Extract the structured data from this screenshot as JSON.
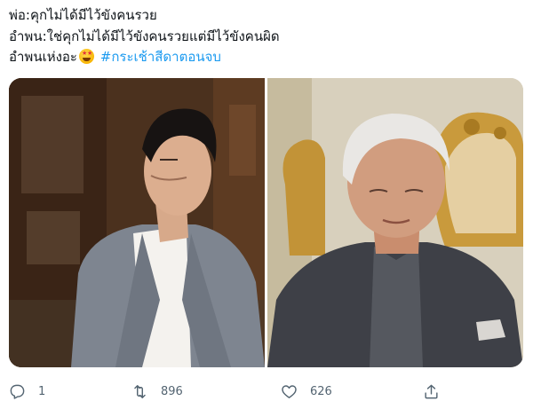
{
  "tweet": {
    "lines": [
      "พ่อ:คุกไม่ได้มีไว้ขังคนรวย",
      "อําพน:ใช่คุกไม่ได้มีไว้ขังคนรวยแต่มีไว้ขังคนผิด"
    ],
    "line3_text": "อําพนเห่งอะ",
    "line3_emoji": "star-struck-emoji",
    "hashtag": "#กระเช้าสีดาตอนจบ"
  },
  "media": {
    "photos": [
      {
        "subject": "young man in grey suit looking down"
      },
      {
        "subject": "older man in grey suit in front of gilded chair"
      }
    ]
  },
  "actions": {
    "reply": {
      "icon": "reply-icon",
      "count": "1"
    },
    "retweet": {
      "icon": "retweet-icon",
      "count": "896"
    },
    "like": {
      "icon": "heart-icon",
      "count": "626"
    },
    "share": {
      "icon": "share-icon"
    }
  },
  "colors": {
    "text": "#0f1419",
    "hashtag": "#1d9bf0",
    "action_gray": "#536471"
  }
}
